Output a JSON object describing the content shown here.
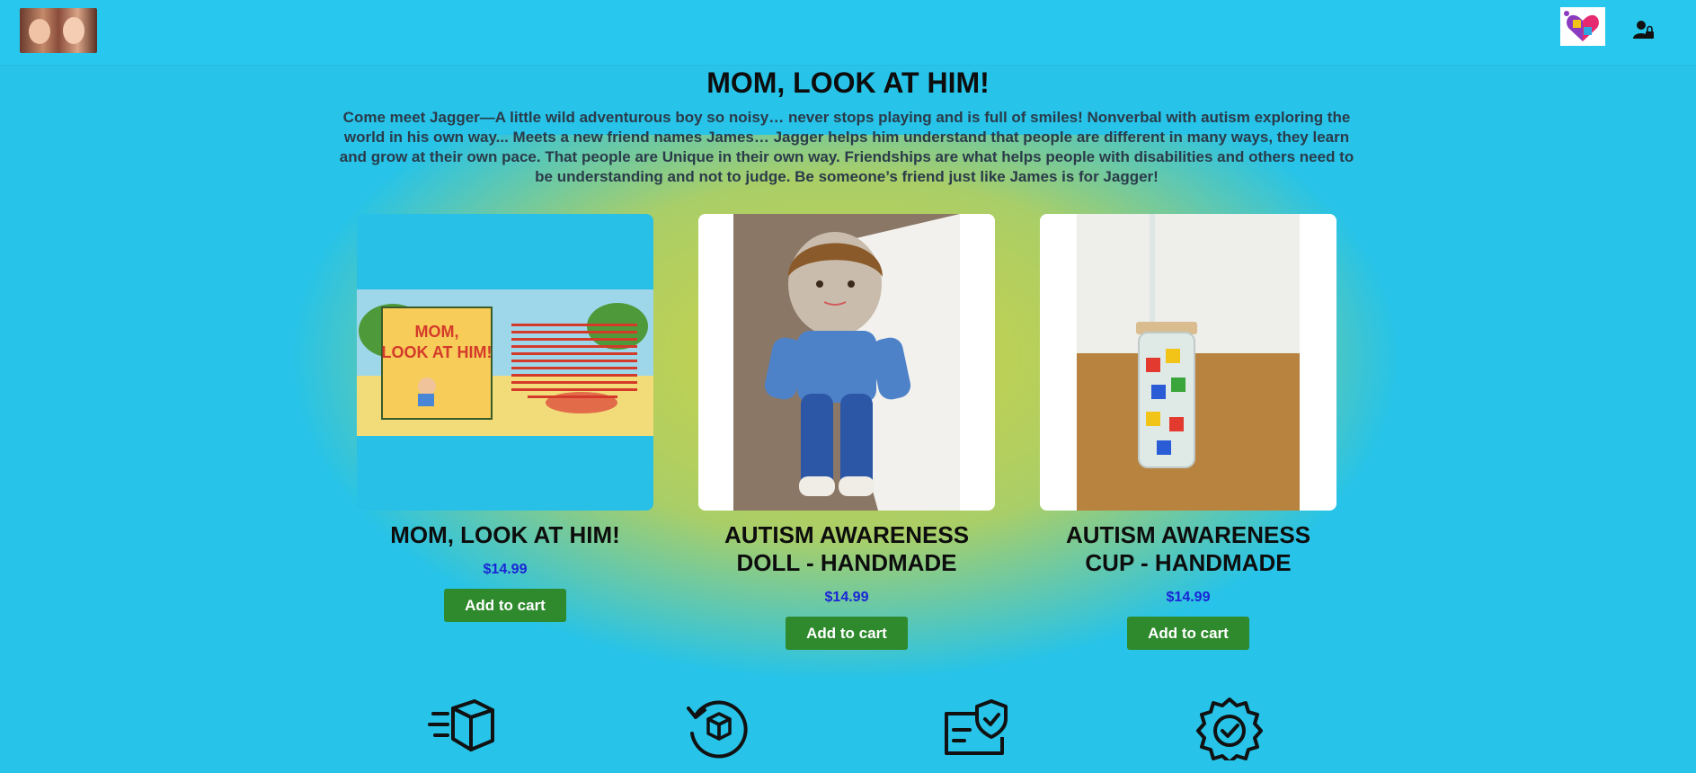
{
  "header": {
    "logo_left": "family-photo-logo",
    "logo_right": "autism-puzzle-heart-logo",
    "account_icon": "user-lock-icon"
  },
  "hero": {
    "title": "MOM, LOOK AT HIM!",
    "description": "Come meet Jagger—A little wild adventurous boy so noisy… never stops playing and is full of smiles! Nonverbal with autism exploring the world in his own way... Meets a new friend names James… Jagger helps him understand that people are different in many ways, they learn and grow at their own pace. That people are Unique in their own way. Friendships are what helps people with disabilities and others need to be understanding and not to judge. Be someone’s friend just like James is for Jagger!"
  },
  "products": [
    {
      "title": "MOM, LOOK AT HIM!",
      "price": "$14.99",
      "button": "Add to cart",
      "image": "book-cover-image"
    },
    {
      "title": "AUTISM AWARENESS DOLL - HANDMADE",
      "price": "$14.99",
      "button": "Add to cart",
      "image": "crochet-doll-image"
    },
    {
      "title": "AUTISM AWARENESS CUP - HANDMADE",
      "price": "$14.99",
      "button": "Add to cart",
      "image": "puzzle-cup-image"
    }
  ],
  "features": [
    {
      "icon": "fast-shipping-box-icon",
      "label": ""
    },
    {
      "icon": "return-box-icon",
      "label": ""
    },
    {
      "icon": "secure-payment-icon",
      "label": ""
    },
    {
      "icon": "quality-badge-icon",
      "label": ""
    }
  ],
  "colors": {
    "background": "#27c3e8",
    "glow": "#d6d23c",
    "price": "#1a24d6",
    "button": "#2e8a2c"
  }
}
